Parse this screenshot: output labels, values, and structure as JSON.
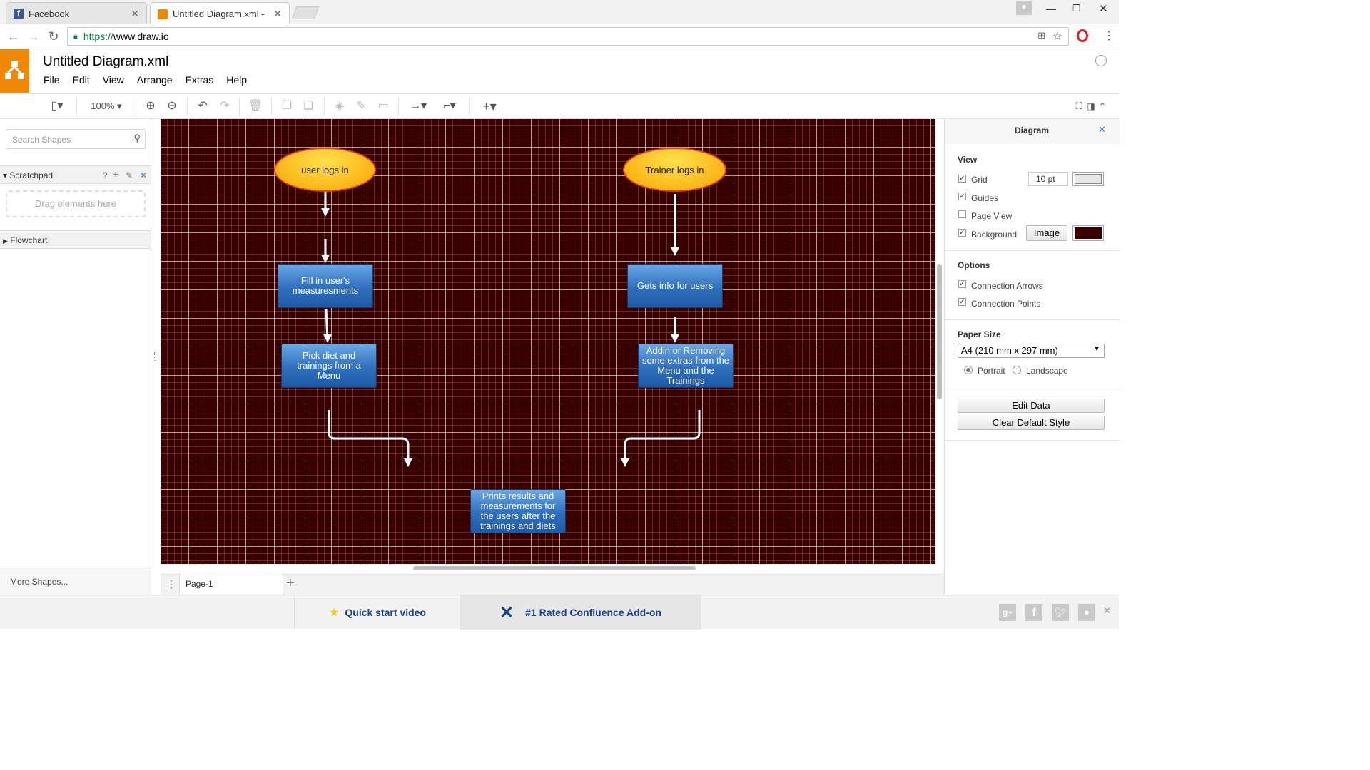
{
  "browser": {
    "tabs": [
      {
        "title": "Facebook",
        "icon": "facebook-icon"
      },
      {
        "title": "Untitled Diagram.xml - d",
        "icon": "drawio-icon"
      }
    ],
    "url_scheme": "https://",
    "url_host": "www.draw.io"
  },
  "app": {
    "doc_title": "Untitled Diagram.xml",
    "menu": [
      "File",
      "Edit",
      "View",
      "Arrange",
      "Extras",
      "Help"
    ],
    "zoom": "100%"
  },
  "sidebar": {
    "search_placeholder": "Search Shapes",
    "scratchpad": "Scratchpad",
    "scratchpad_help": "?",
    "dropzone": "Drag elements here",
    "flowchart": "Flowchart",
    "more_shapes": "More Shapes..."
  },
  "diagram": {
    "nodes": [
      {
        "id": "user-logs-in",
        "text": "user logs in"
      },
      {
        "id": "trainer-logs-in",
        "text": "Trainer logs in"
      },
      {
        "id": "fill-measurements",
        "text": "Fill in user's measuresments"
      },
      {
        "id": "gets-info",
        "text": "Gets info for users"
      },
      {
        "id": "pick-diet",
        "text": "Pick diet and trainings from a Menu"
      },
      {
        "id": "addin-removing",
        "text": "Addin or Removing some extras from the Menu and the Trainings"
      },
      {
        "id": "prints-results",
        "text": "Prints results and measurements for the users after the trainings and diets"
      }
    ],
    "background_color": "#3a0000"
  },
  "pages": {
    "current": "Page-1"
  },
  "panel": {
    "title": "Diagram",
    "view_heading": "View",
    "grid": "Grid",
    "grid_size": "10 pt",
    "guides": "Guides",
    "page_view": "Page View",
    "background": "Background",
    "image_button": "Image",
    "options_heading": "Options",
    "connection_arrows": "Connection Arrows",
    "connection_points": "Connection Points",
    "paper_size_heading": "Paper Size",
    "paper_size_value": "A4 (210 mm x 297 mm)",
    "portrait": "Portrait",
    "landscape": "Landscape",
    "edit_data": "Edit Data",
    "clear_style": "Clear Default Style"
  },
  "footer": {
    "quick_start": "Quick start video",
    "confluence": "#1 Rated Confluence Add-on"
  },
  "colors": {
    "accent": "#f08705",
    "canvas": "#3a0000",
    "link": "#1a3f8a"
  }
}
